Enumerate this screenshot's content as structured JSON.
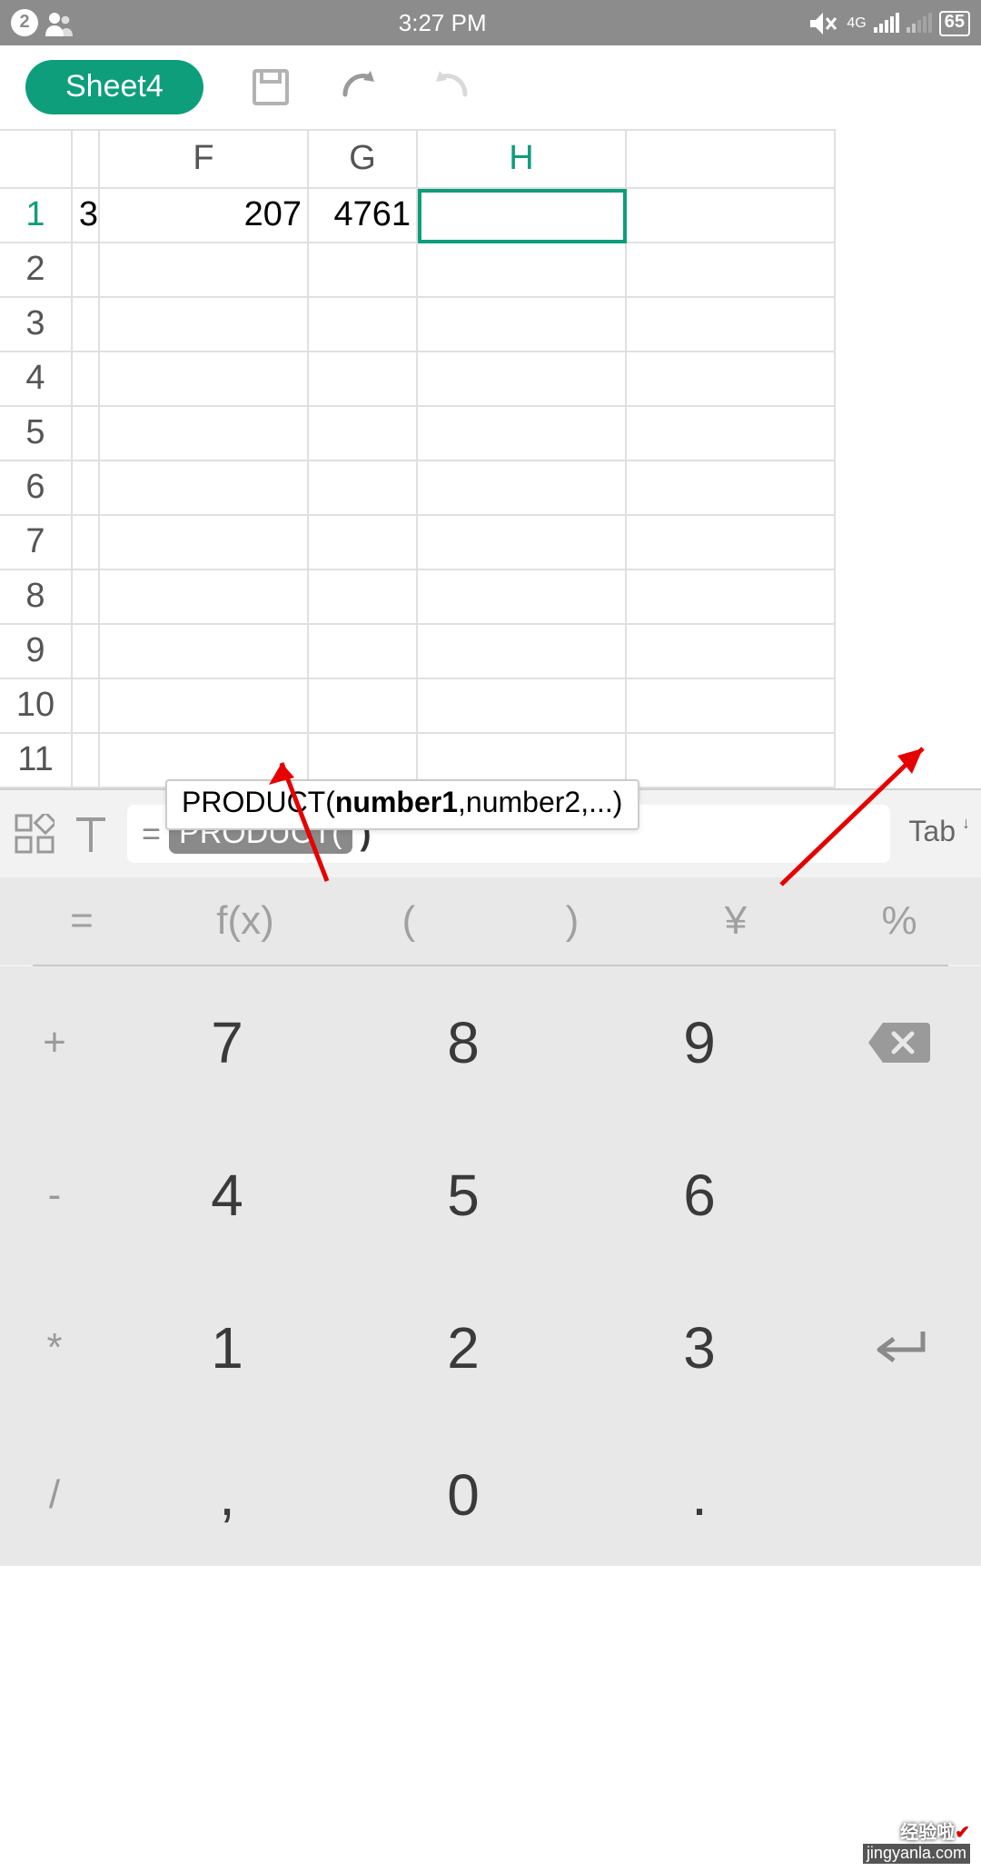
{
  "status": {
    "notif": "2",
    "time": "3:27 PM",
    "signal_label": "4G",
    "battery": "65"
  },
  "toolbar": {
    "sheet_name": "Sheet4"
  },
  "columns": {
    "frag": "",
    "F": "F",
    "G": "G",
    "H": "H",
    "I": ""
  },
  "rows": [
    {
      "num": "1",
      "frag": "3",
      "F": "207",
      "G": "4761",
      "H": "",
      "I": "",
      "active": true,
      "sel": "H"
    },
    {
      "num": "2"
    },
    {
      "num": "3"
    },
    {
      "num": "4"
    },
    {
      "num": "5"
    },
    {
      "num": "6"
    },
    {
      "num": "7"
    },
    {
      "num": "8"
    },
    {
      "num": "9"
    },
    {
      "num": "10"
    },
    {
      "num": "11"
    }
  ],
  "tooltip": {
    "fn": "PRODUCT(",
    "arg1": "number1",
    "rest": ",number2,...)"
  },
  "formula": {
    "eq": "=",
    "chip": "PRODUCT(",
    "close": ")",
    "tab": "Tab"
  },
  "sec_keys": [
    "=",
    "f(x)",
    "(",
    ")",
    "¥",
    "%"
  ],
  "keypad": [
    {
      "side": "+",
      "a": "7",
      "b": "8",
      "c": "9",
      "action": "backspace"
    },
    {
      "side": "-",
      "a": "4",
      "b": "5",
      "c": "6",
      "action": ""
    },
    {
      "side": "*",
      "a": "1",
      "b": "2",
      "c": "3",
      "action": "enter"
    },
    {
      "side": "/",
      "a": ",",
      "b": "0",
      "c": ".",
      "action": ""
    }
  ],
  "watermark": {
    "l1": "经验啦",
    "l2": "jingyanla.com"
  }
}
